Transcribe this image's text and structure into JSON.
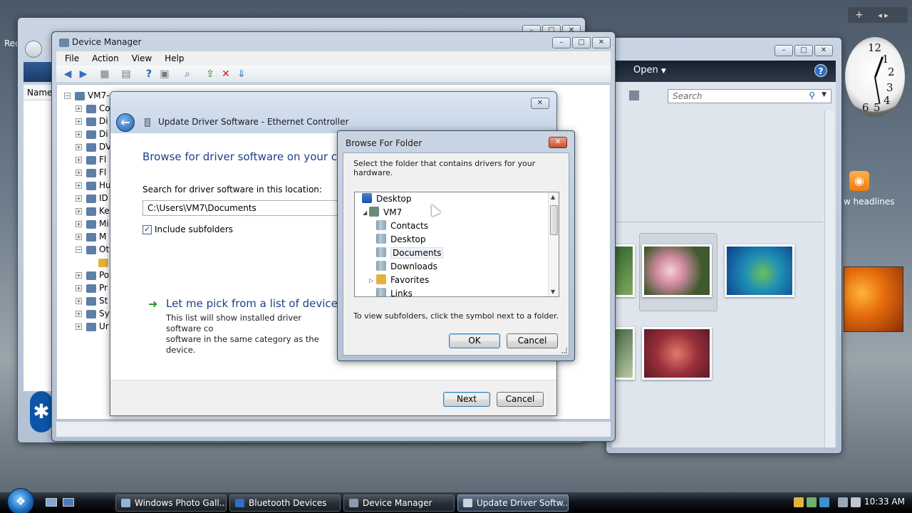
{
  "desktop": {
    "recycle_label": "Rec",
    "gadget_bar_plus": "+",
    "gadget_bar_nav": "◂ ▸",
    "clock_numbers": [
      "12",
      "1",
      "2",
      "3",
      "4",
      "5",
      "6"
    ],
    "feed_label": "w headlines",
    "bluetooth_glyph": "✱"
  },
  "photo_window": {
    "open_label": "Open",
    "search_placeholder": "Search",
    "help_label": "?"
  },
  "background_window": {
    "column_header": "Name"
  },
  "device_manager": {
    "title": "Device Manager",
    "menu": [
      "File",
      "Action",
      "View",
      "Help"
    ],
    "tree_root": "VM7-",
    "tree_items": [
      "Co",
      "Di",
      "Di",
      "DV",
      "Fl",
      "Fl",
      "Hu",
      "ID",
      "Ke",
      "Mi",
      "M",
      "Ot",
      "",
      "Po",
      "Pr",
      "St",
      "Sy",
      "Ur"
    ]
  },
  "wizard": {
    "title": "Update Driver Software - Ethernet Controller",
    "heading": "Browse for driver software on your com",
    "search_label": "Search for driver software in this location:",
    "path_value": "C:\\Users\\VM7\\Documents",
    "include_subfolders": "Include subfolders",
    "pick_title": "Let me pick from a list of device dri",
    "pick_desc_line1": "This list will show installed driver software co",
    "pick_desc_line2": "software in the same category as the device.",
    "next_label": "Next",
    "cancel_label": "Cancel"
  },
  "browse_dialog": {
    "title": "Browse For Folder",
    "instruction": "Select the folder that contains drivers for your hardware.",
    "tree": [
      {
        "label": "Desktop",
        "icon": "desktop-icon"
      },
      {
        "label": "VM7",
        "icon": "user-folder-icon"
      },
      {
        "label": "Contacts",
        "icon": "folder-icon"
      },
      {
        "label": "Desktop",
        "icon": "folder-icon"
      },
      {
        "label": "Documents",
        "icon": "folder-icon",
        "selected": true
      },
      {
        "label": "Downloads",
        "icon": "folder-icon"
      },
      {
        "label": "Favorites",
        "icon": "favorites-icon"
      },
      {
        "label": "Links",
        "icon": "folder-icon"
      }
    ],
    "hint": "To view subfolders, click the symbol next to a folder.",
    "ok_label": "OK",
    "cancel_label": "Cancel"
  },
  "taskbar": {
    "start_glyph": "❖",
    "tasks": [
      {
        "label": "Windows Photo Gall..."
      },
      {
        "label": "Bluetooth Devices"
      },
      {
        "label": "Device Manager"
      },
      {
        "label": "Update Driver Softw..."
      }
    ],
    "clock": "10:33 AM"
  }
}
